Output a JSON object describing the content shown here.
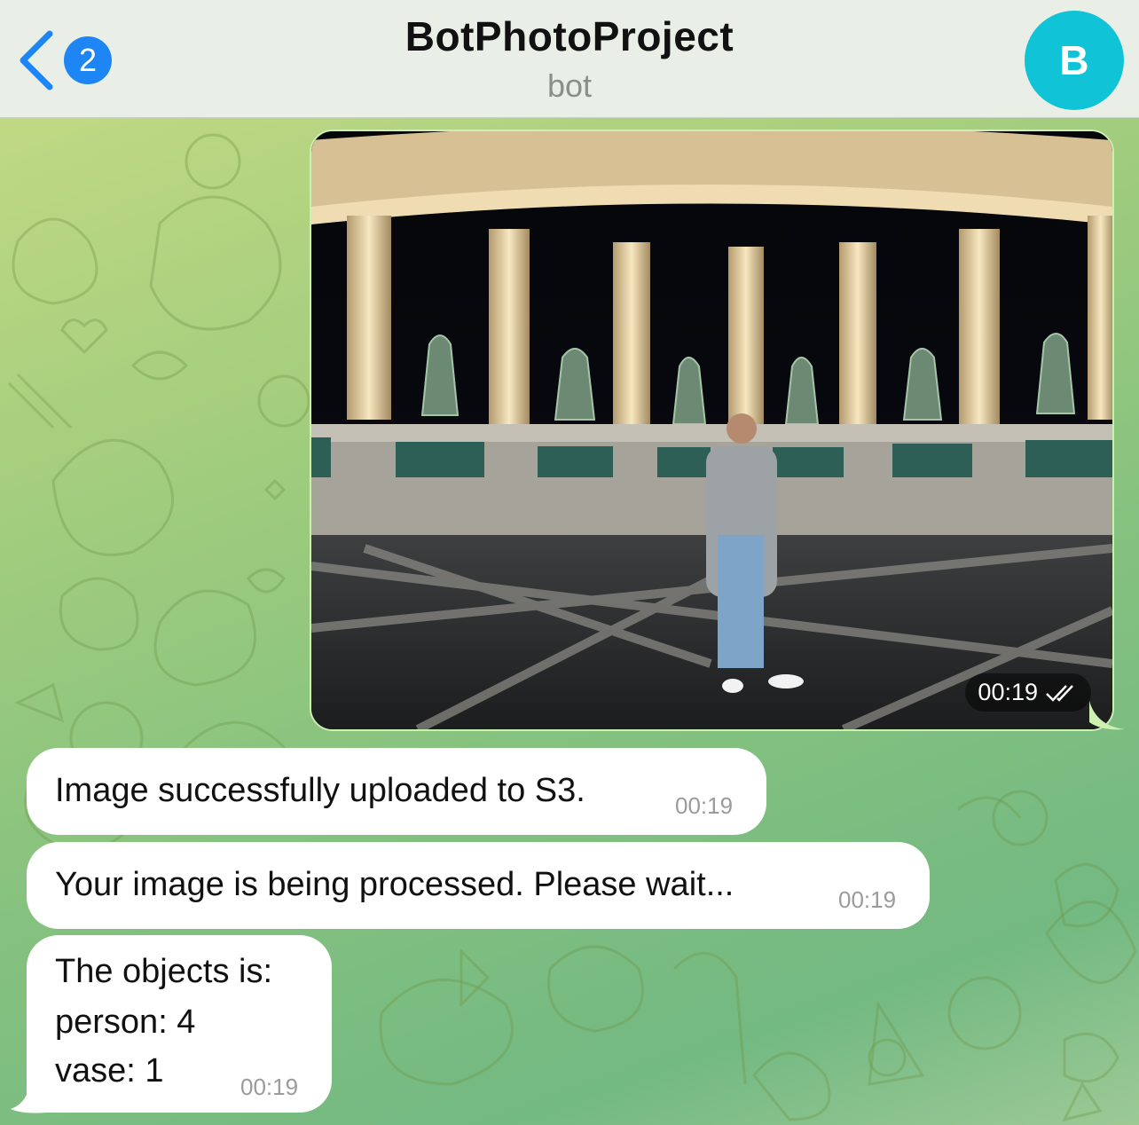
{
  "header": {
    "back_badge": "2",
    "title": "BotPhotoProject",
    "subtitle": "bot",
    "avatar_letter": "B"
  },
  "colors": {
    "accent": "#1d86f4",
    "avatar": "#10c3d6",
    "outgoing_border": "#cdefb2",
    "chat_bg": "#86c27f"
  },
  "messages": [
    {
      "type": "photo",
      "direction": "outgoing",
      "time": "00:19",
      "status_icon": "double-check-icon"
    },
    {
      "type": "text",
      "direction": "incoming",
      "text": "Image successfully uploaded to S3.",
      "time": "00:19"
    },
    {
      "type": "text",
      "direction": "incoming",
      "text": "Your image is being processed. Please wait...",
      "time": "00:19"
    },
    {
      "type": "text",
      "direction": "incoming",
      "lines": [
        "The objects is:",
        "person: 4",
        "vase: 1"
      ],
      "time": "00:19"
    }
  ]
}
